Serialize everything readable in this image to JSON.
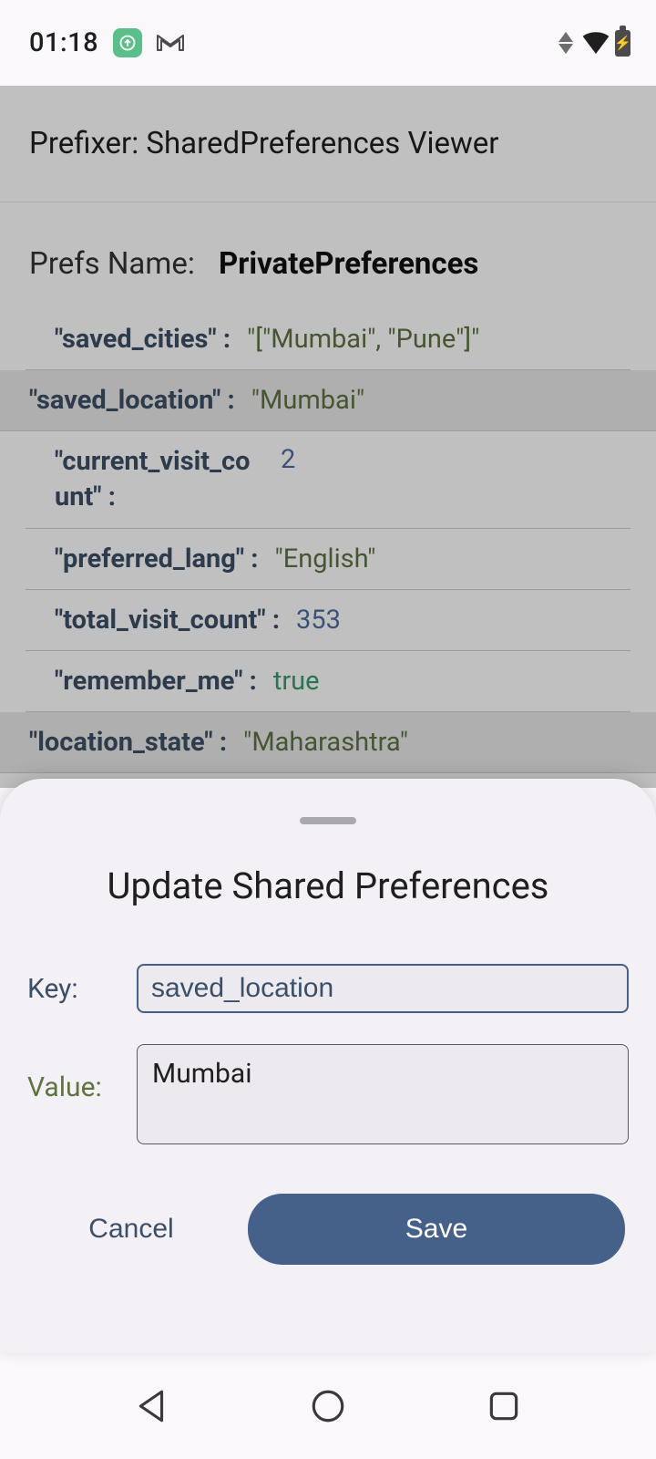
{
  "status_bar": {
    "time": "01:18"
  },
  "app": {
    "title": "Prefixer: SharedPreferences Viewer",
    "prefs_label": "Prefs Name:",
    "prefs_name": "PrivatePreferences"
  },
  "rows": {
    "r0": {
      "key": "\"saved_cities\" :",
      "val": "\"[\"Mumbai\", \"Pune\"]\""
    },
    "r1": {
      "key": "\"saved_location\" :",
      "val": "\"Mumbai\""
    },
    "r2": {
      "key": "\"current_visit_count\" :",
      "val": "2"
    },
    "r3": {
      "key": "\"preferred_lang\" :",
      "val": "\"English\""
    },
    "r4": {
      "key": "\"total_visit_count\" :",
      "val": "353"
    },
    "r5": {
      "key": "\"remember_me\" :",
      "val": "true"
    },
    "r6": {
      "key": "\"location_state\" :",
      "val": "\"Maharashtra\""
    }
  },
  "sheet": {
    "title": "Update Shared Preferences",
    "key_label": "Key:",
    "key_value": "saved_location",
    "value_label": "Value:",
    "value_value": "Mumbai",
    "cancel": "Cancel",
    "save": "Save"
  }
}
